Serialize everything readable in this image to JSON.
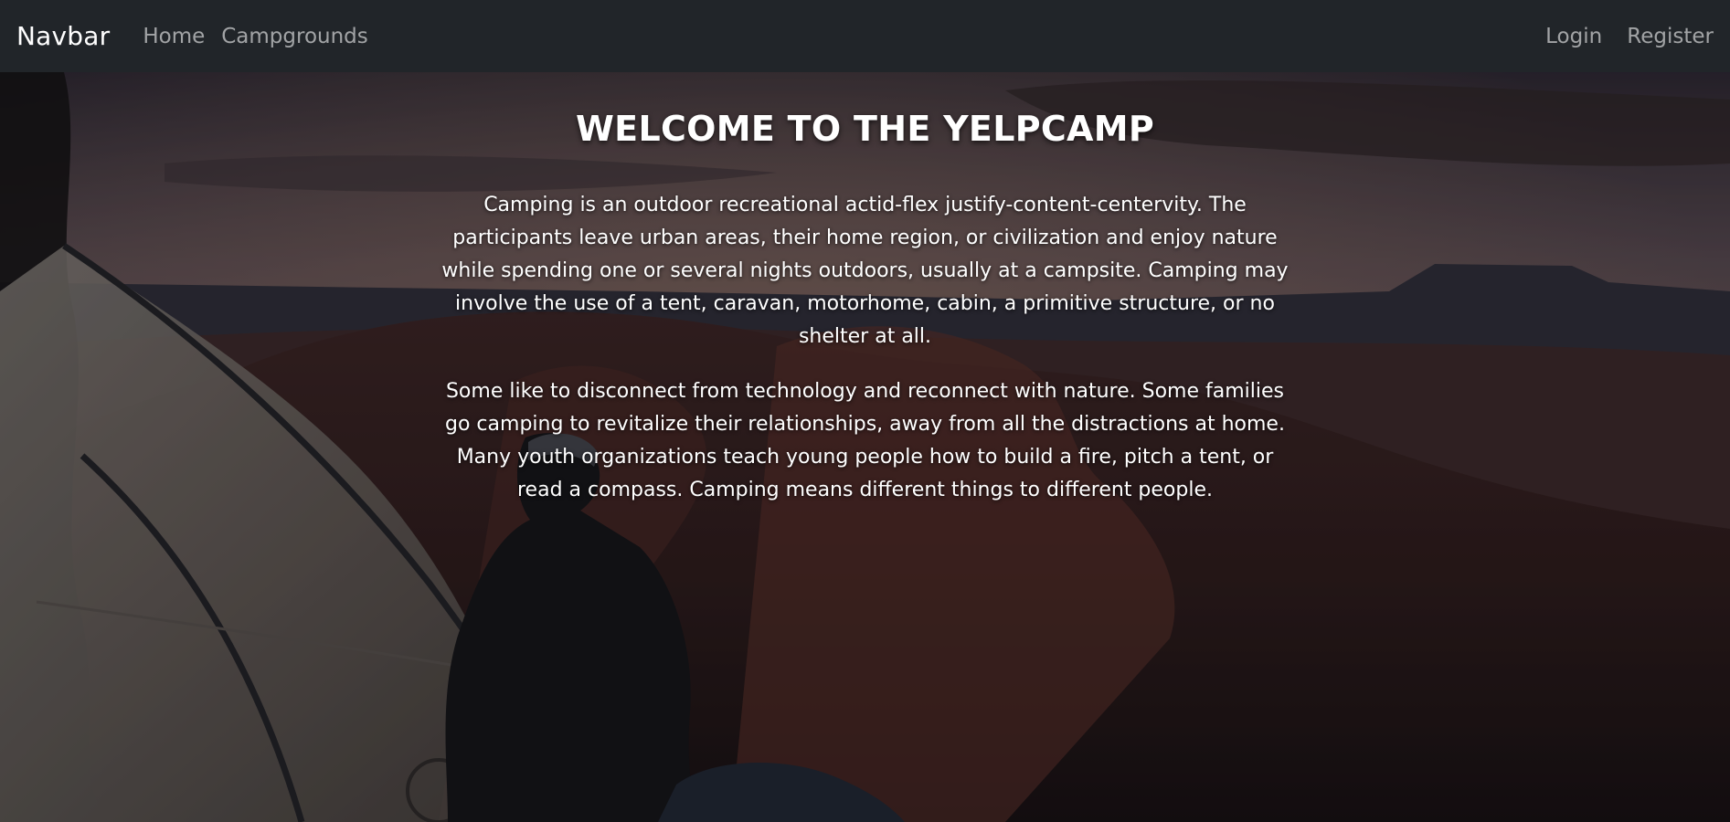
{
  "navbar": {
    "brand": "Navbar",
    "links_left": [
      "Home",
      "Campgrounds"
    ],
    "links_right": [
      "Login",
      "Register"
    ]
  },
  "hero": {
    "title": "WELCOME TO THE YELPCAMP",
    "paragraphs": [
      "Camping is an outdoor recreational actid-flex justify-content-centervity. The participants leave urban areas, their home region, or civilization and enjoy nature while spending one or several nights outdoors, usually at a campsite. Camping may involve the use of a tent, caravan, motorhome, cabin, a primitive structure, or no shelter at all.",
      "Some like to disconnect from technology and reconnect with nature. Some families go camping to revitalize their relationships, away from all the distractions at home. Many youth organizations teach young people how to build a fire, pitch a tent, or read a compass. Camping means different things to different people."
    ]
  },
  "colors": {
    "navbar_bg": "#212529",
    "nav_link": "#9b9ea1",
    "brand": "#ffffff",
    "hero_text": "#ffffff"
  }
}
